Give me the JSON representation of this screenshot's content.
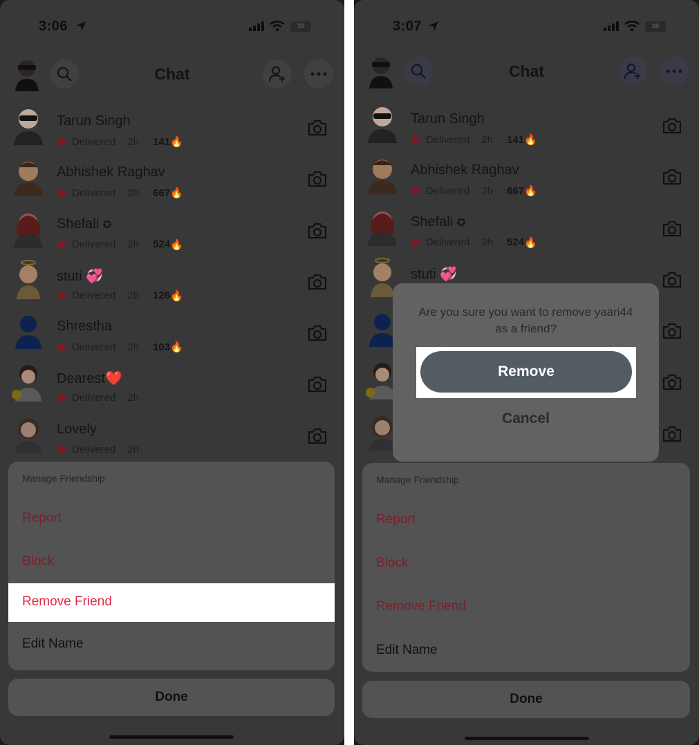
{
  "left": {
    "status": {
      "time": "3:06",
      "battery": "38"
    },
    "header": {
      "title": "Chat"
    },
    "chats": [
      {
        "name": "Tarun Singh",
        "status": "Delivered",
        "time": "2h",
        "streak": "141",
        "emoji": "🔥"
      },
      {
        "name": "Abhishek Raghav",
        "status": "Delivered",
        "time": "2h",
        "streak": "667",
        "emoji": "🔥"
      },
      {
        "name": "Shefali",
        "badge": "✪",
        "status": "Delivered",
        "time": "2h",
        "streak": "524",
        "emoji": "🔥"
      },
      {
        "name": "stuti",
        "badge": "💞",
        "status": "Delivered",
        "time": "2h",
        "streak": "126",
        "emoji": "🔥"
      },
      {
        "name": "Shrestha",
        "status": "Delivered",
        "time": "2h",
        "streak": "103",
        "emoji": "🔥"
      },
      {
        "name": "Dearest",
        "badge": "❤️",
        "status": "Delivered",
        "time": "2h"
      },
      {
        "name": "Lovely",
        "status": "Delivered",
        "time": "2h"
      }
    ],
    "sheet": {
      "header": "Manage Friendship",
      "items": [
        "Report",
        "Block",
        "Remove Friend",
        "Edit Name"
      ],
      "done": "Done"
    }
  },
  "right": {
    "status": {
      "time": "3:07",
      "battery": "38"
    },
    "header": {
      "title": "Chat"
    },
    "chats": [
      {
        "name": "Tarun Singh",
        "status": "Delivered",
        "time": "2h",
        "streak": "141",
        "emoji": "🔥"
      },
      {
        "name": "Abhishek Raghav",
        "status": "Delivered",
        "time": "2h",
        "streak": "667",
        "emoji": "🔥"
      },
      {
        "name": "Shefali",
        "badge": "✪",
        "status": "Delivered",
        "time": "2h",
        "streak": "524",
        "emoji": "🔥"
      },
      {
        "name": "stuti",
        "badge": "💞"
      }
    ],
    "dialog": {
      "message": "Are you sure you want to remove yaari44 as a friend?",
      "remove": "Remove",
      "cancel": "Cancel"
    },
    "sheet": {
      "header": "Manage Friendship",
      "items": [
        "Report",
        "Block",
        "Remove Friend",
        "Edit Name"
      ],
      "done": "Done"
    }
  },
  "colors": {
    "accent_red": "#e02a47",
    "snap_arrow": "#c8122d"
  }
}
